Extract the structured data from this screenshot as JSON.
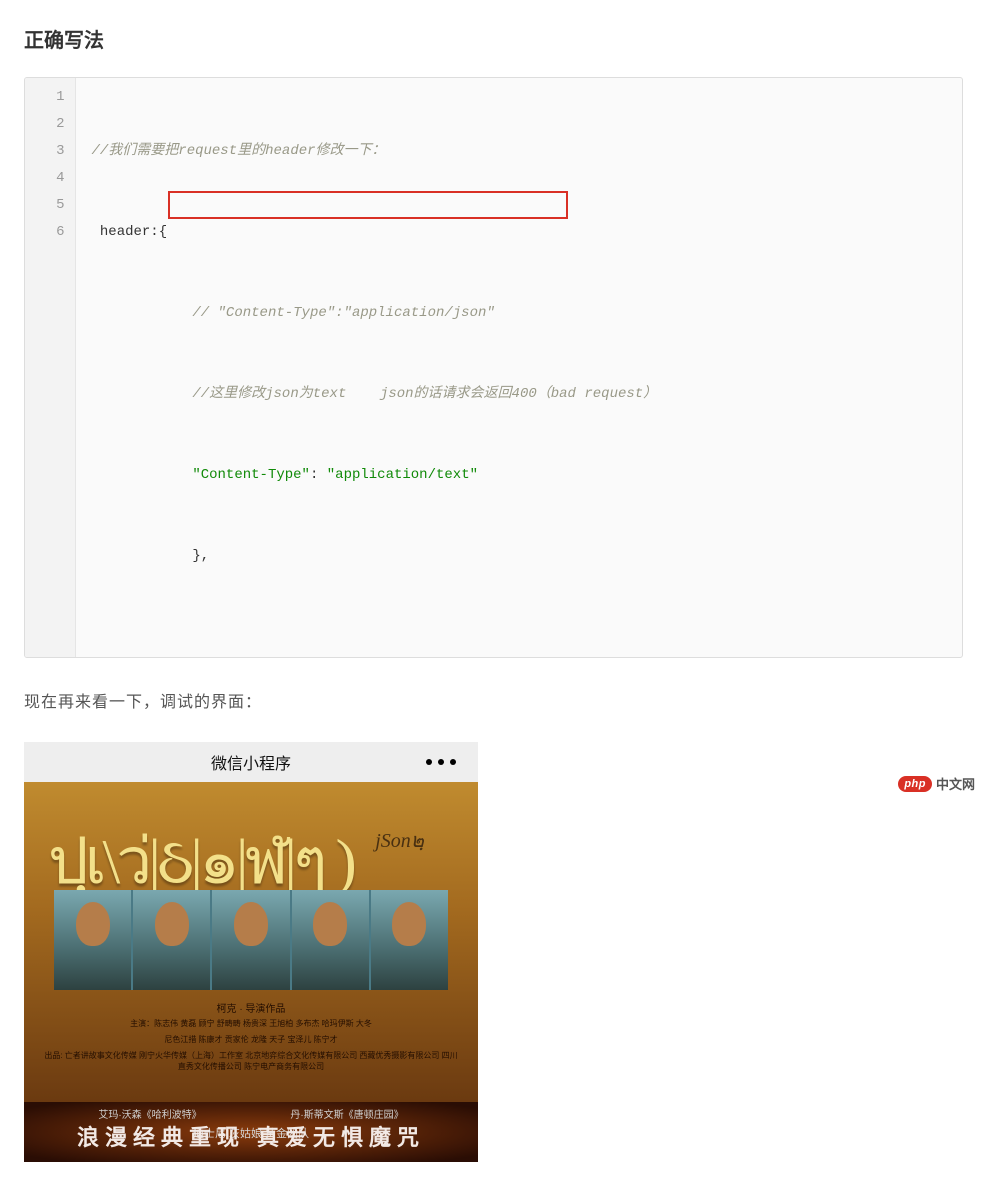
{
  "heading": "正确写法",
  "code": {
    "line1": "//我们需要把request里的header修改一下：",
    "line2": " header:{",
    "line3_indent": "            ",
    "line3": "// \"Content-Type\":\"application/json\"",
    "line4_indent": "            ",
    "line4": "//这里修改json为text    json的话请求会返回400（bad request）",
    "line5_indent": "            ",
    "line5a": "\"Content-Type\"",
    "line5b": ": ",
    "line5c": "\"application/text\"",
    "line6_indent": "            ",
    "line6": "},"
  },
  "line_numbers": [
    "1",
    "2",
    "3",
    "4",
    "5",
    "6"
  ],
  "paragraph": "现在再来看一下，调试的界面：",
  "app": {
    "header_title": "微信小程序",
    "tibetan": "ปฺเ\\ว่|ઠ|๑|ฬ|ๆ )",
    "tibetan_side": "jSon๒ฺ",
    "credits_line1": "柯克 · 导演作品",
    "credits_line2": "主演：陈志伟 黄磊 顾宁 舒畴畴 杨贵深 王旭柏 多布杰 哈玛伊斯 大冬",
    "credits_line3": "尼色江措 陈康才 贡家伦 龙隆 天子 宝泽儿 陈宁才",
    "credits_line4": "出品: 亡者讲故事文化传媒 刚宁火华传媒（上海）工作室 北京地弈综合文化传媒有限公司\n西藏优秀摄影有限公司 四川直秀文化传播公司 陈宁电产商务有限公司",
    "poster_sub_left": "艾玛·沃森《哈利波特》",
    "poster_sub_right": "丹·斯蒂文斯《唐顿庄园》",
    "poster_sub_mid": "迪士尼 灰姑娘 黄金团队",
    "tagline": "浪漫经典重现  真爱无惧魔咒"
  },
  "watermark": {
    "badge": "php",
    "text": "中文网"
  }
}
